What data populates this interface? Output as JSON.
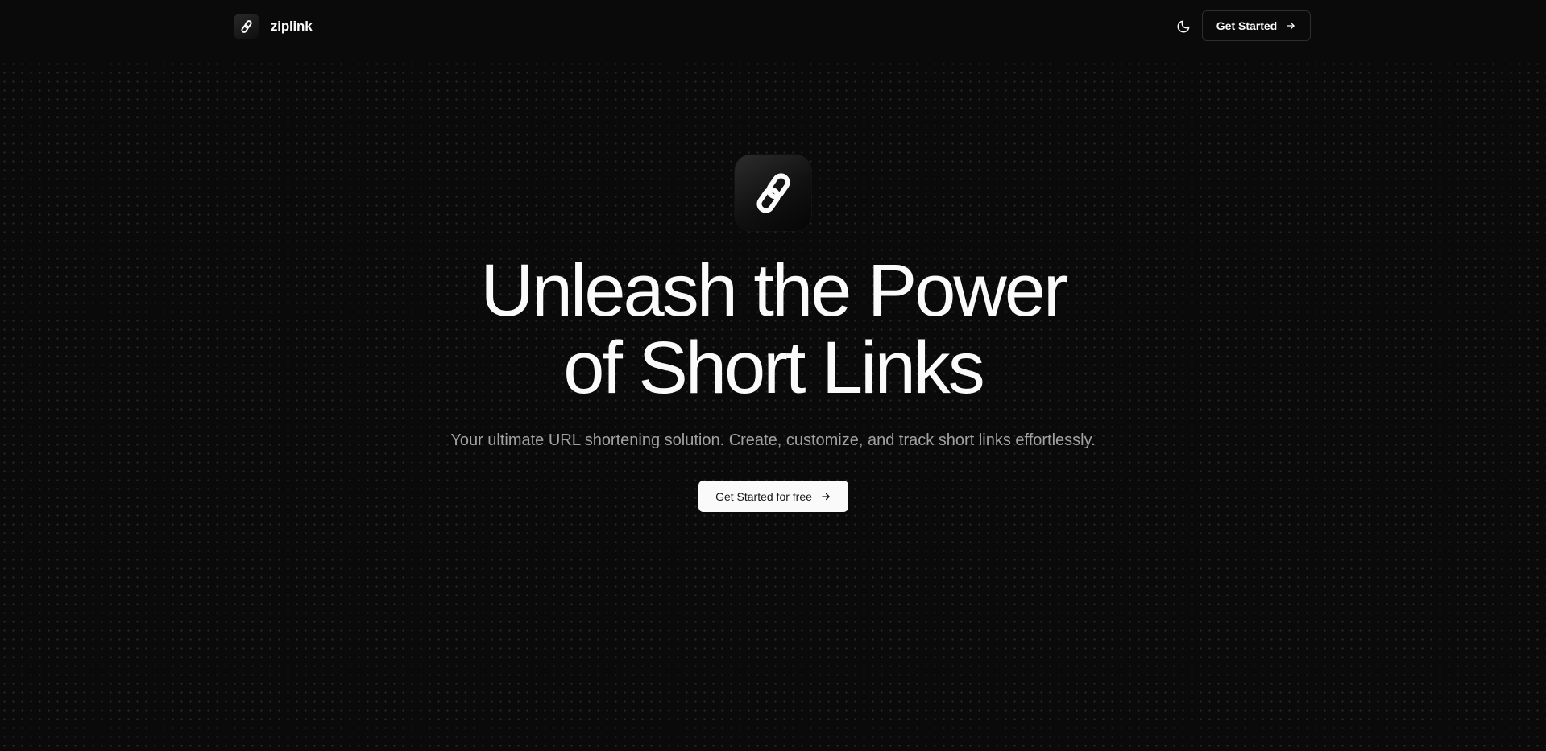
{
  "header": {
    "brand_name": "ziplink",
    "brand_icon": "link-icon",
    "theme_toggle_icon": "moon-icon",
    "cta_label": "Get Started",
    "cta_icon": "arrow-right-icon"
  },
  "hero": {
    "logo_icon": "link-icon",
    "title_line_1": "Unleash the Power",
    "title_line_2": "of Short Links",
    "subtitle": "Your ultimate URL shortening solution. Create, customize, and track short links effortlessly.",
    "cta_label": "Get Started for free",
    "cta_icon": "arrow-right-icon"
  },
  "colors": {
    "background": "#0a0a0a",
    "foreground": "#fafafa",
    "muted_text": "#a1a1a1",
    "primary_button_bg": "#fafafa",
    "primary_button_text": "#171717",
    "border": "#2e2e2e"
  }
}
